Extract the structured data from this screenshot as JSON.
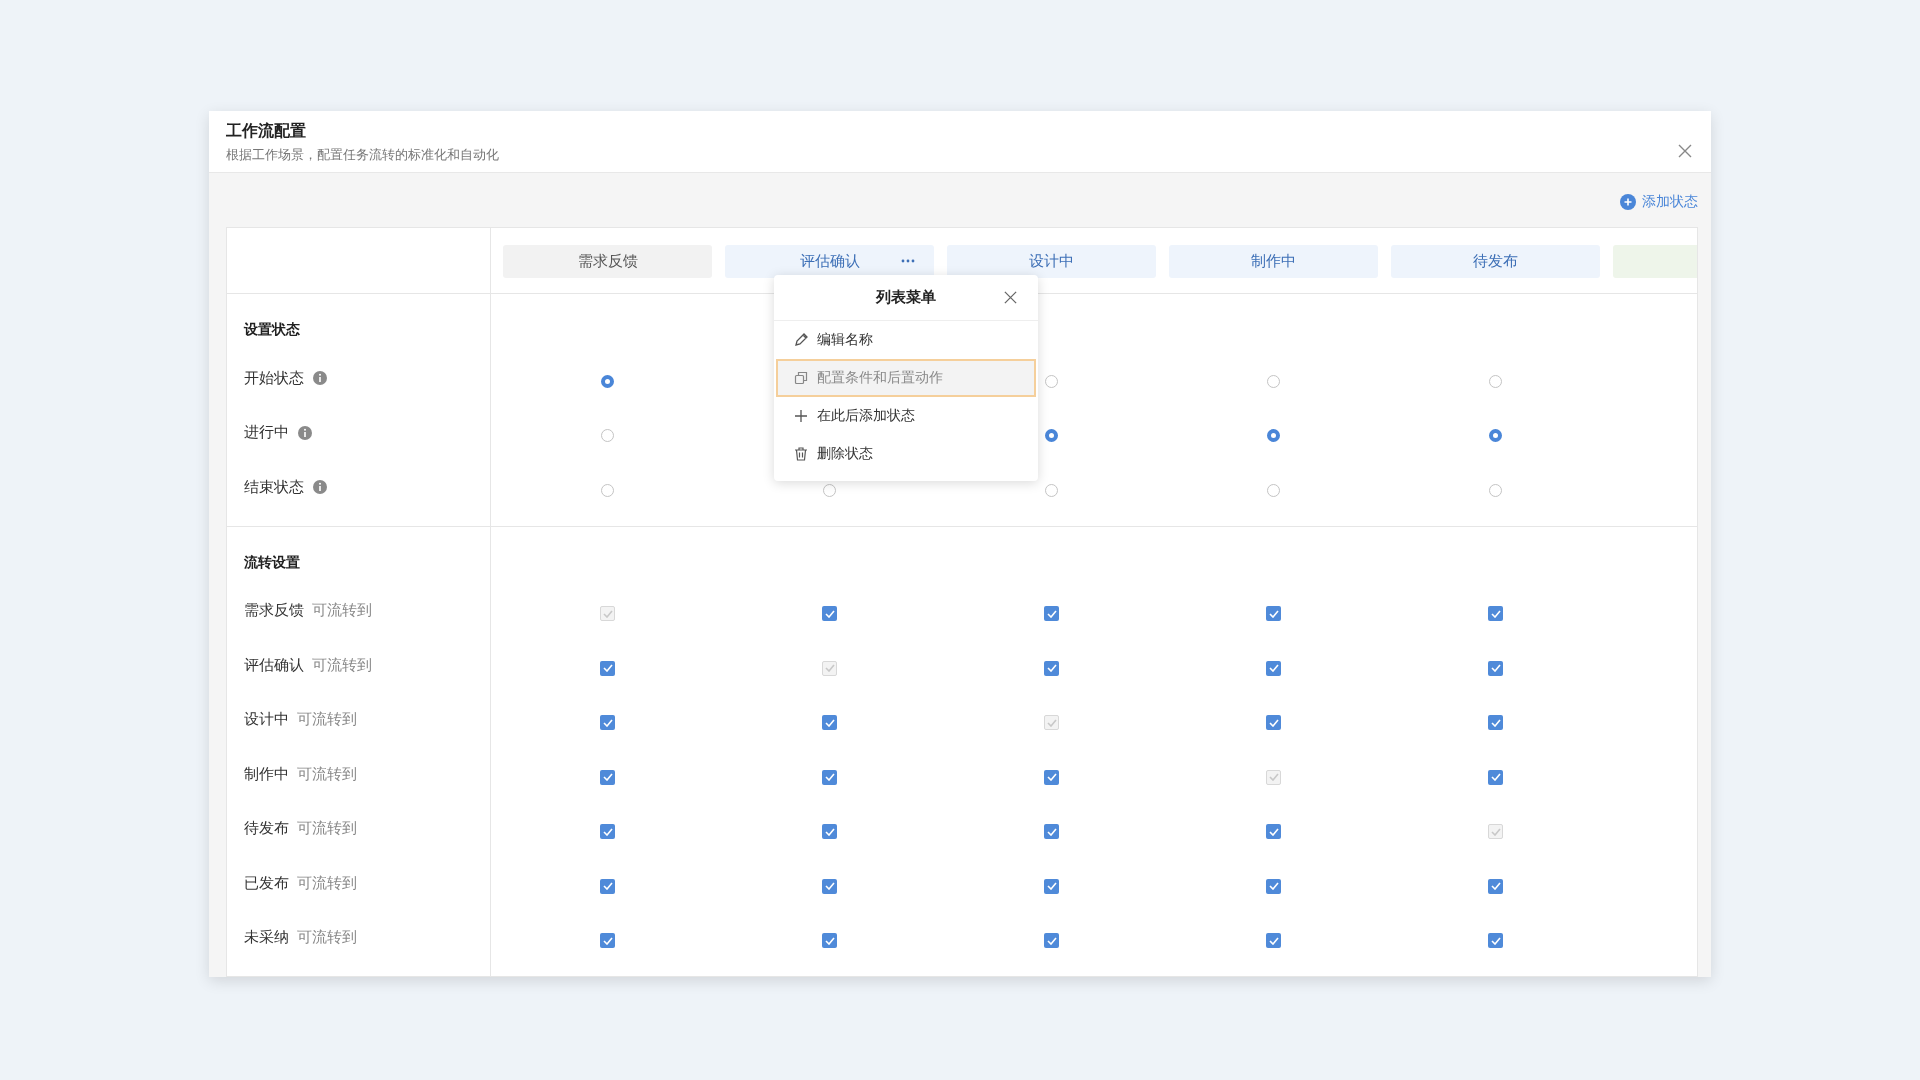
{
  "dialog": {
    "title": "工作流配置",
    "subtitle": "根据工作场景，配置任务流转的标准化和自动化"
  },
  "add_status": "添加状态",
  "columns": [
    {
      "label": "需求反馈",
      "color": "#f2f2f2",
      "menu": false
    },
    {
      "label": "评估确认",
      "color": "#eef4fc",
      "menu": true
    },
    {
      "label": "设计中",
      "color": "#eef4fc",
      "menu": false
    },
    {
      "label": "制作中",
      "color": "#eef4fc",
      "menu": false
    },
    {
      "label": "待发布",
      "color": "#eef4fc",
      "menu": false
    },
    {
      "color": "#eef5ea",
      "menu": false
    }
  ],
  "status_section": {
    "title": "设置状态",
    "rows": [
      {
        "label": "开始状态",
        "kind": "covered",
        "radios": [
          {
            "selected": true
          },
          {
            "selected": false
          },
          {
            "selected": false
          },
          {
            "selected": false
          }
        ]
      },
      {
        "label": "进行中",
        "kind": "covered",
        "radios": [
          {
            "selected": false
          },
          {
            "selected": true
          },
          {
            "selected": true
          },
          {
            "selected": true
          }
        ]
      },
      {
        "label": "结束状态",
        "kind": "open",
        "radios": [
          {
            "selected": false
          },
          {
            "selected": false
          },
          {
            "selected": false
          },
          {
            "selected": false
          },
          {
            "selected": false
          }
        ]
      }
    ]
  },
  "flow_section": {
    "title": "流转设置",
    "rows": [
      {
        "label": "需求反馈",
        "hint": "可流转到",
        "cells": [
          {
            "checked": true,
            "disabled": true
          },
          {
            "checked": true,
            "disabled": false
          },
          {
            "checked": true,
            "disabled": false
          },
          {
            "checked": true,
            "disabled": false
          },
          {
            "checked": true,
            "disabled": false
          }
        ]
      },
      {
        "label": "评估确认",
        "hint": "可流转到",
        "cells": [
          {
            "checked": true,
            "disabled": false
          },
          {
            "checked": true,
            "disabled": true
          },
          {
            "checked": true,
            "disabled": false
          },
          {
            "checked": true,
            "disabled": false
          },
          {
            "checked": true,
            "disabled": false
          }
        ]
      },
      {
        "label": "设计中",
        "hint": "可流转到",
        "cells": [
          {
            "checked": true,
            "disabled": false
          },
          {
            "checked": true,
            "disabled": false
          },
          {
            "checked": true,
            "disabled": true
          },
          {
            "checked": true,
            "disabled": false
          },
          {
            "checked": true,
            "disabled": false
          }
        ]
      },
      {
        "label": "制作中",
        "hint": "可流转到",
        "cells": [
          {
            "checked": true,
            "disabled": false
          },
          {
            "checked": true,
            "disabled": false
          },
          {
            "checked": true,
            "disabled": false
          },
          {
            "checked": true,
            "disabled": true
          },
          {
            "checked": true,
            "disabled": false
          }
        ]
      },
      {
        "label": "待发布",
        "hint": "可流转到",
        "cells": [
          {
            "checked": true,
            "disabled": false
          },
          {
            "checked": true,
            "disabled": false
          },
          {
            "checked": true,
            "disabled": false
          },
          {
            "checked": true,
            "disabled": false
          },
          {
            "checked": true,
            "disabled": true
          }
        ]
      },
      {
        "label": "已发布",
        "hint": "可流转到",
        "cells": [
          {
            "checked": true,
            "disabled": false
          },
          {
            "checked": true,
            "disabled": false
          },
          {
            "checked": true,
            "disabled": false
          },
          {
            "checked": true,
            "disabled": false
          },
          {
            "checked": true,
            "disabled": false
          }
        ]
      },
      {
        "label": "未采纳",
        "hint": "可流转到",
        "cells": [
          {
            "checked": true,
            "disabled": false
          },
          {
            "checked": true,
            "disabled": false
          },
          {
            "checked": true,
            "disabled": false
          },
          {
            "checked": true,
            "disabled": false
          },
          {
            "checked": true,
            "disabled": false
          }
        ]
      }
    ]
  },
  "menu": {
    "title": "列表菜单",
    "items": [
      {
        "label": "编辑名称",
        "kind": "edit",
        "selected": false
      },
      {
        "label": "配置条件和后置动作",
        "kind": "config",
        "selected": true
      },
      {
        "label": "在此后添加状态",
        "kind": "add",
        "selected": false
      },
      {
        "label": "删除状态",
        "kind": "delete",
        "selected": false
      }
    ]
  }
}
